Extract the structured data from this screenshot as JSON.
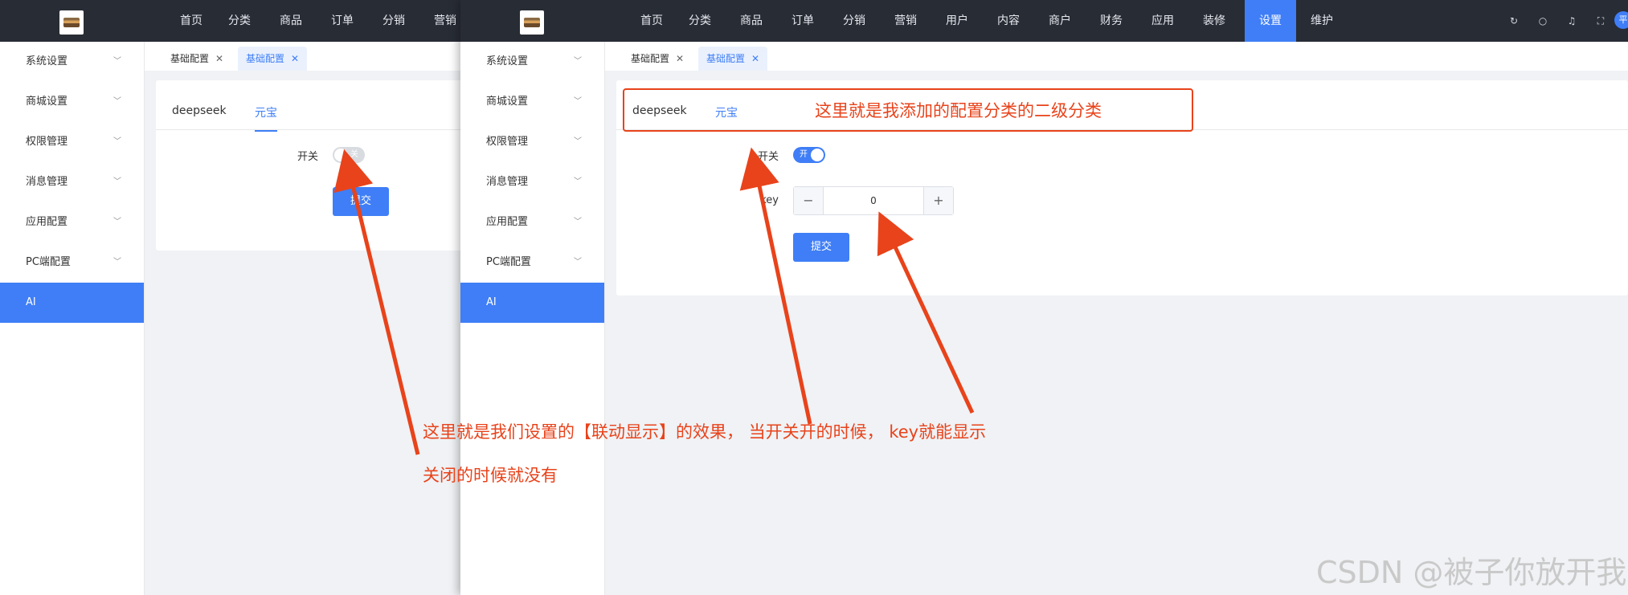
{
  "left_window": {
    "nav": [
      "首页",
      "分类",
      "商品",
      "订单",
      "分销",
      "营销"
    ],
    "sidebar": [
      "系统设置",
      "商城设置",
      "权限管理",
      "消息管理",
      "应用配置",
      "PC端配置",
      "AI"
    ],
    "tabs": [
      {
        "label": "基础配置"
      },
      {
        "label": "基础配置"
      }
    ],
    "inner_tabs": [
      "deepseek",
      "元宝"
    ],
    "form": {
      "switch_label": "开关",
      "switch_state_text": "关",
      "submit": "提交"
    }
  },
  "right_window": {
    "nav": [
      "首页",
      "分类",
      "商品",
      "订单",
      "分销",
      "营销",
      "用户",
      "内容",
      "商户",
      "财务",
      "应用",
      "装修",
      "设置",
      "维护"
    ],
    "active_nav": "设置",
    "sidebar": [
      "系统设置",
      "商城设置",
      "权限管理",
      "消息管理",
      "应用配置",
      "PC端配置",
      "AI"
    ],
    "tabs": [
      {
        "label": "基础配置"
      },
      {
        "label": "基础配置"
      }
    ],
    "inner_tabs": [
      "deepseek",
      "元宝"
    ],
    "form": {
      "switch_label": "开关",
      "switch_state_text": "开",
      "key_label": "key",
      "key_value": "0",
      "minus": "−",
      "plus": "+",
      "submit": "提交"
    },
    "avatar_text": "平"
  },
  "icons": [
    "refresh-icon",
    "search-icon",
    "bell-icon",
    "fullscreen-icon",
    "close-icon",
    "chevron-down-icon"
  ],
  "annotations": {
    "callout": "这里就是我添加的配置分类的二级分类",
    "line1": "这里就是我们设置的【联动显示】的效果， 当开关开的时候， key就能显示",
    "line2": "关闭的时候就没有"
  },
  "watermark": "CSDN @被子你放开我",
  "colors": {
    "accent": "#3f7ef6",
    "topbar": "#282c35",
    "annotation": "#e8431b"
  }
}
